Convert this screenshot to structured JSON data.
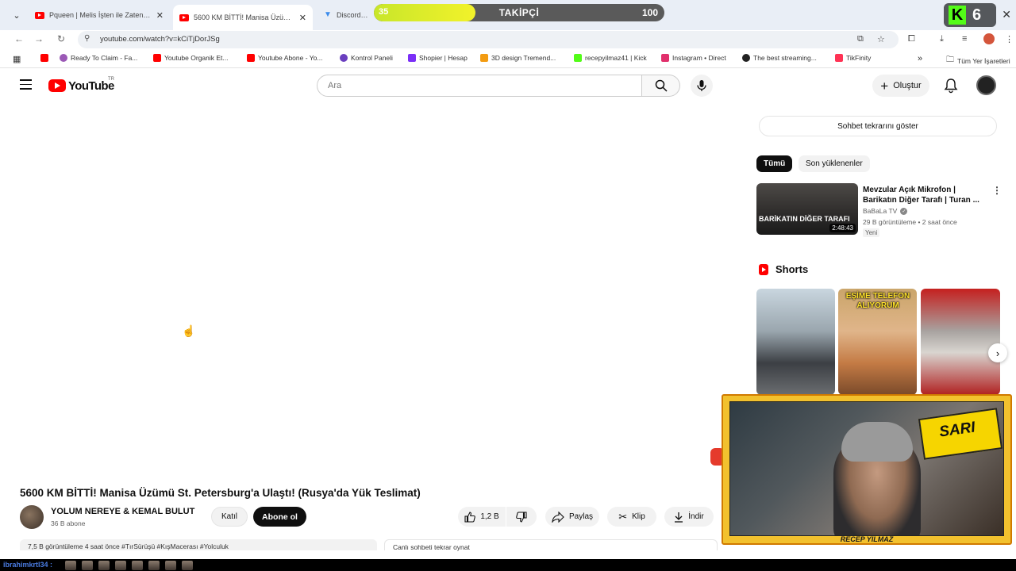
{
  "browser": {
    "tabs": [
      {
        "title": "Pqueen | Melis İşten ile Zaten Ç..."
      },
      {
        "title": "5600 KM BİTTİ! Manisa Üzümü S..."
      },
      {
        "title": "Discord İnd..."
      }
    ],
    "url": "youtube.com/watch?v=kCiTjDorJSg",
    "bookmarks": [
      {
        "label": "Ready To Claim - Fa...",
        "color": "#9b59b6"
      },
      {
        "label": "Youtube Organik Et...",
        "color": "#ff0000"
      },
      {
        "label": "Youtube Abone - Yo...",
        "color": "#ff0000"
      },
      {
        "label": "Kontrol Paneli",
        "color": "#6a3fbf"
      },
      {
        "label": "Shopier | Hesap",
        "color": "#7b2ff7"
      },
      {
        "label": "3D design Tremend...",
        "color": "#f39c12"
      },
      {
        "label": "recepyilmaz41 | Kick",
        "color": "#53fc18"
      },
      {
        "label": "Instagram • Direct",
        "color": "#e1306c"
      },
      {
        "label": "The best streaming...",
        "color": "#222222"
      },
      {
        "label": "TikFinity",
        "color": "#ff3355"
      }
    ],
    "all_bookmarks": "Tüm Yer İşaretleri"
  },
  "overlay": {
    "follower_current": "35",
    "follower_label": "TAKİPÇİ",
    "follower_goal": "100",
    "follower_progress": 0.35,
    "kick_logo": "K",
    "kick_count": "6"
  },
  "youtube": {
    "logo": "YouTube",
    "country": "TR",
    "search_placeholder": "Ara",
    "create_label": "Oluştur"
  },
  "video": {
    "title": "5600 KM BİTTİ! Manisa Üzümü St. Petersburg'a Ulaştı! (Rusya'da Yük Teslimat)",
    "channel": "YOLUM NEREYE & KEMAL BULUT",
    "subscribers": "36 B abone",
    "join_label": "Katıl",
    "subscribe_label": "Abone ol",
    "likes": "1,2 B",
    "share_label": "Paylaş",
    "clip_label": "Klip",
    "download_label": "İndir",
    "description": "7,5 B görüntüleme  4 saat önce  #TırSürüşü #KışMacerası #Yolculuk",
    "replay_chat": "Canlı sohbeti tekrar oynat"
  },
  "sidebar": {
    "chat_replay_button": "Sohbet tekrarını göster",
    "chips": [
      "Tümü",
      "Son yüklenenler"
    ],
    "recommended": {
      "thumb_text": "BARİKATIN DİĞER TARAFI",
      "duration": "2:48:43",
      "title": "Mevzular Açık Mikrofon | Barikatın Diğer Tarafı | Turan ...",
      "channel": "BaBaLa TV",
      "meta": "29 B görüntüleme • 2 saat önce",
      "badge": "Yeni"
    },
    "shorts_title": "Shorts",
    "short_2_text": "EŞİME TELEFON ALIYORUM"
  },
  "webcam": {
    "sign_text": "SARI",
    "streamer_name": "RECEP YILMAZ"
  },
  "chat": {
    "username": "ibrahimkrtl34 :"
  }
}
